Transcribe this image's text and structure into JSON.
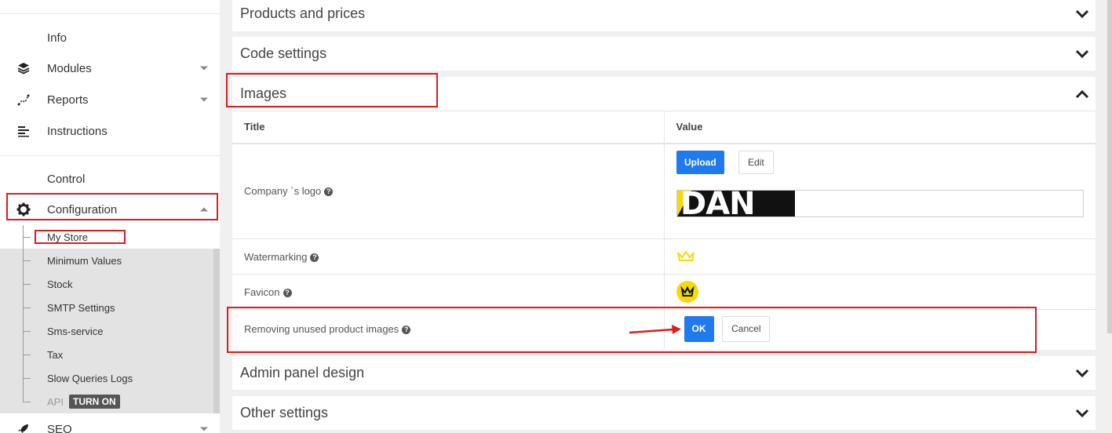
{
  "sidebar": {
    "items": [
      {
        "label": "Info"
      },
      {
        "label": "Modules",
        "icon": "layers-icon"
      },
      {
        "label": "Reports",
        "icon": "chart-line-icon"
      },
      {
        "label": "Instructions",
        "icon": "list-icon"
      },
      {
        "label": "Control"
      },
      {
        "label": "Configuration",
        "icon": "gear-icon"
      },
      {
        "label": "SEO",
        "icon": "rocket-icon"
      }
    ],
    "submenu": [
      {
        "label": "My Store"
      },
      {
        "label": "Minimum Values"
      },
      {
        "label": "Stock"
      },
      {
        "label": "SMTP Settings"
      },
      {
        "label": "Sms-service"
      },
      {
        "label": "Tax"
      },
      {
        "label": "Slow Queries Logs"
      },
      {
        "label": "API",
        "badge": "TURN ON"
      }
    ]
  },
  "sections": {
    "products_prices": "Products and prices",
    "code_settings": "Code settings",
    "images": "Images",
    "admin_design": "Admin panel design",
    "other_settings": "Other settings"
  },
  "images_table": {
    "col_title": "Title",
    "col_value": "Value",
    "rows": [
      {
        "title": "Company `s logo"
      },
      {
        "title": "Watermarking"
      },
      {
        "title": "Favicon"
      },
      {
        "title": "Removing unused product images"
      }
    ],
    "upload_label": "Upload",
    "edit_label": "Edit",
    "ok_label": "OK",
    "cancel_label": "Cancel",
    "logo_text": "DAN"
  },
  "colors": {
    "accent": "#1f7af0",
    "highlight": "#e01b1b",
    "brand_yellow": "#f5d90a"
  }
}
